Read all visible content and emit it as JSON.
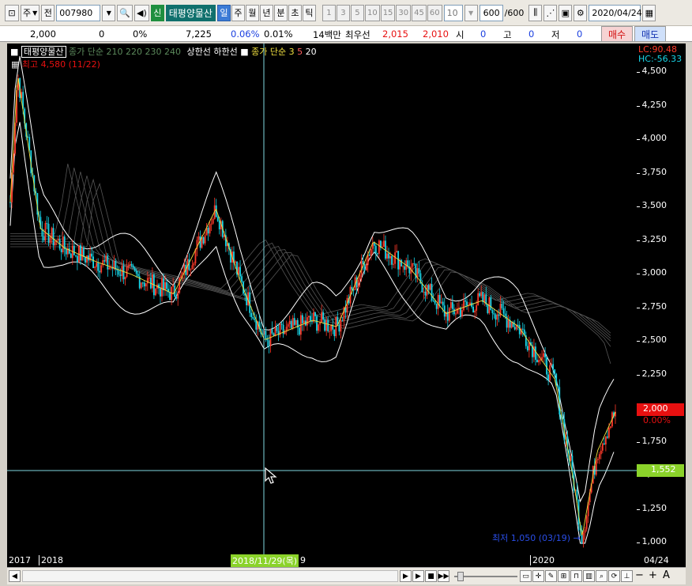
{
  "toolbar": {
    "type_label": "주",
    "prev_label": "전",
    "code": "007980",
    "shin_label": "신",
    "stock_name": "태평양물산",
    "periods": [
      "일",
      "주",
      "월",
      "년",
      "분",
      "초",
      "틱"
    ],
    "active_period": "일",
    "intervals": [
      "1",
      "3",
      "5",
      "10",
      "15",
      "30",
      "45",
      "60"
    ],
    "interval_value": "10",
    "count": "600",
    "count_total": "/600",
    "date": "2020/04/24"
  },
  "quote": {
    "price": "2,000",
    "change": "0",
    "change_pct": "0%",
    "volume": "7,225",
    "vol_pct": "0.06%",
    "turnover": "0.01%",
    "amount": "14백만",
    "best_label": "최우선",
    "ask": "2,015",
    "bid": "2,010",
    "open_label": "시",
    "open_val": "0",
    "high_label": "고",
    "high_val": "0",
    "low_label": "저",
    "low_val": "0",
    "buy_label": "매수",
    "sell_label": "매도"
  },
  "legend": {
    "name": "태평양물산",
    "ma_text": "종가 단순 210 220 230 240",
    "limit_up": "상한선",
    "limit_down": "하한선",
    "close_text": "종가 단순",
    "p3": "3",
    "p5": "5",
    "p20": "20",
    "high_note": "최고 4,580 (11/22)",
    "low_note": "최저 1,050 (03/19)"
  },
  "axis": {
    "lc": "LC:90.48",
    "hc": "HC:-56.33",
    "ticks": [
      "4,500",
      "4,250",
      "4,000",
      "3,750",
      "3,500",
      "3,250",
      "3,000",
      "2,750",
      "2,500",
      "2,250",
      "2,000",
      "1,750",
      "1,500",
      "1,250",
      "1,000"
    ],
    "current_price": "2,000",
    "current_pct": "0.00%",
    "cursor_price": "1,552"
  },
  "xaxis": {
    "labels": [
      "2017",
      "2018",
      "9",
      "2020"
    ],
    "cursor_date": "2018/11/29(목)",
    "end_date": "04/24"
  },
  "colors": {
    "up": "#ff3a2a",
    "down": "#18d6e8",
    "accent": "#3b7bd6",
    "price_tag": "#e81010",
    "cursor_tag": "#8bd32a"
  },
  "chart_data": {
    "type": "candlestick",
    "title": "태평양물산",
    "ylim": [
      1000,
      4580
    ],
    "x": [
      "2017",
      "2018",
      "2019",
      "2020",
      "04/24"
    ],
    "approx_close": [
      {
        "period": "2017 start",
        "value": 3600
      },
      {
        "period": "2017 peak (11/22)",
        "value": 4580
      },
      {
        "period": "2018 early",
        "value": 3250
      },
      {
        "period": "2018 mid",
        "value": 3050
      },
      {
        "period": "2018/11/29",
        "value": 2550
      },
      {
        "period": "2019 mid",
        "value": 3300
      },
      {
        "period": "2019 end",
        "value": 2700
      },
      {
        "period": "2020/03/19 low",
        "value": 1050
      },
      {
        "period": "2020/04/24",
        "value": 2000
      }
    ]
  }
}
